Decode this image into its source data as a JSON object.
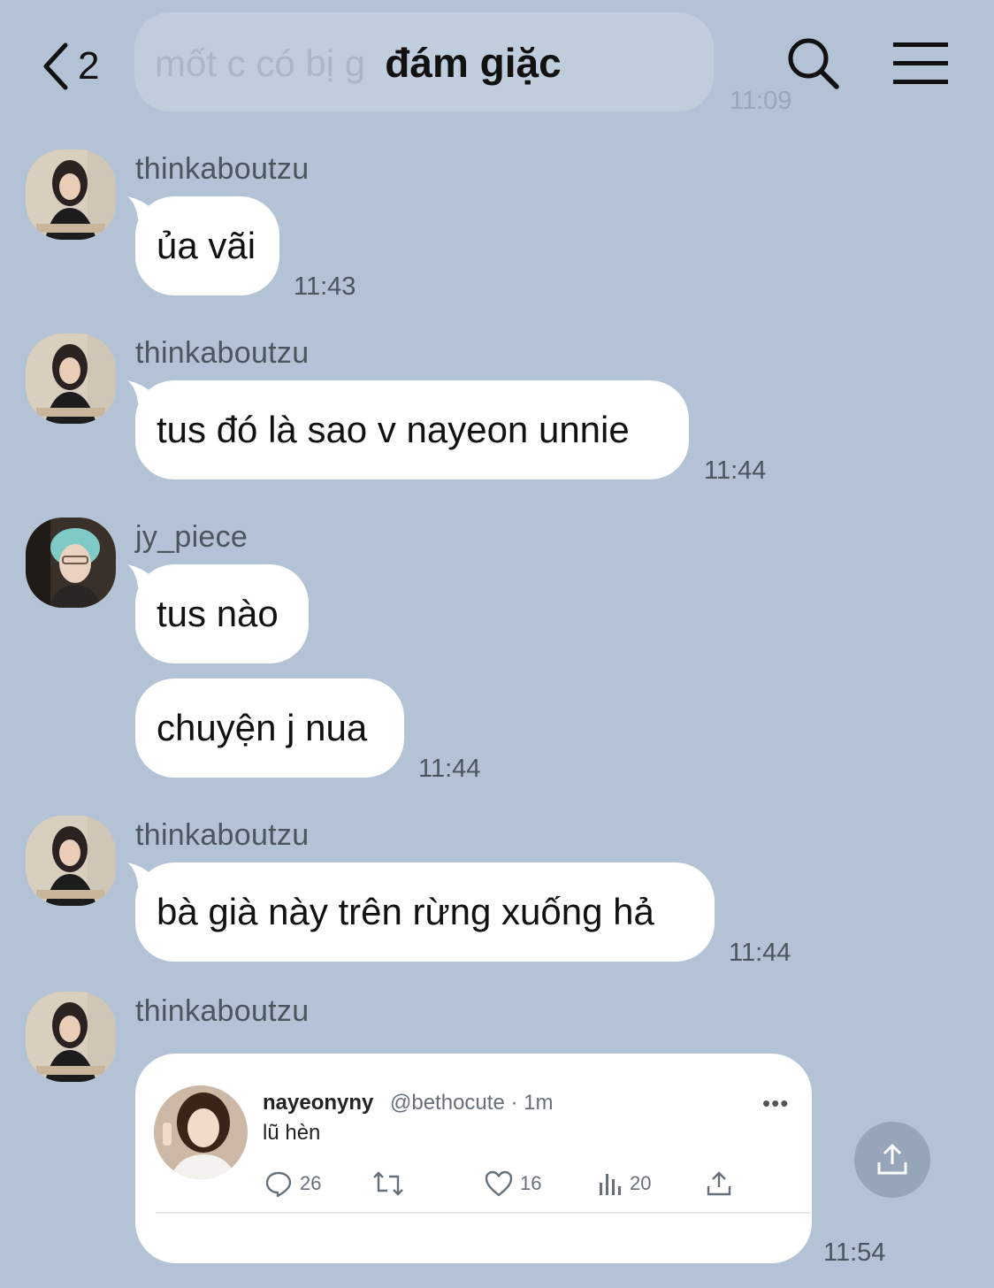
{
  "header": {
    "back_count": "2",
    "title": "đám giặc",
    "previous_message_preview": "mốt c có bị g",
    "previous_message_time": "11:09"
  },
  "messages": [
    {
      "user": "thinkaboutzu",
      "text": "ủa vãi",
      "time": "11:43"
    },
    {
      "user": "thinkaboutzu",
      "text": "tus đó là sao v nayeon unnie",
      "time": "11:44"
    },
    {
      "user": "jy_piece",
      "text": "tus nào"
    },
    {
      "text": "chuyện j nua",
      "time": "11:44"
    },
    {
      "user": "thinkaboutzu",
      "text": "bà già này trên rừng xuống hả",
      "time": "11:44"
    },
    {
      "user": "thinkaboutzu",
      "time": "11:54"
    }
  ],
  "tweet": {
    "name": "nayeonyny",
    "handle_time": "@bethocute · 1m",
    "text": "lũ hèn",
    "replies": "26",
    "likes": "16",
    "views": "20"
  },
  "icons": {
    "back": "chevron-left-icon",
    "search": "search-icon",
    "menu": "hamburger-menu-icon",
    "share": "share-icon"
  },
  "colors": {
    "background": "#b3c3d5",
    "bubble": "#ffffff",
    "meta_text": "#4b5560"
  }
}
